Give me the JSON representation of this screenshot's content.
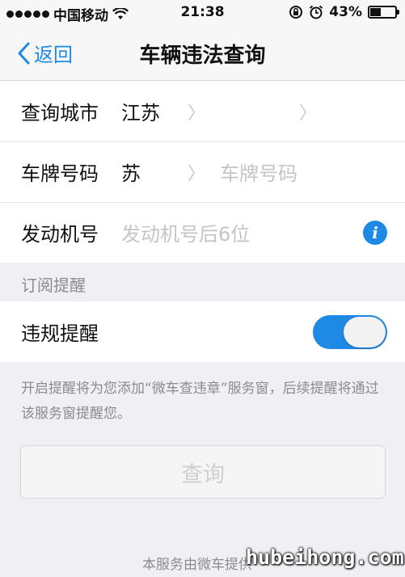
{
  "status_bar": {
    "carrier": "中国移动",
    "time": "21:38",
    "battery": "43%",
    "battery_level": 0.43,
    "icons": [
      "signal-dots-icon",
      "wifi-icon",
      "rotation-lock-icon",
      "alarm-icon",
      "battery-icon"
    ]
  },
  "nav": {
    "back_label": "返回",
    "title": "车辆违法查询"
  },
  "form": {
    "city": {
      "label": "查询城市",
      "value": "江苏"
    },
    "plate": {
      "label": "车牌号码",
      "prefix": "苏",
      "placeholder": "车牌号码"
    },
    "engine": {
      "label": "发动机号",
      "placeholder": "发动机号后6位"
    }
  },
  "subscribe": {
    "section_title": "订阅提醒",
    "toggle_label": "违规提醒",
    "toggle_on": true,
    "hint": "开启提醒将为您添加“微车查违章”服务窗，后续提醒将通过该服务窗提醒您。"
  },
  "query_button_label": "查询",
  "footer_text": "本服务由微车提供",
  "watermark": "hubeihong.com",
  "colors": {
    "accent": "#1f8ae6",
    "background": "#efeff4",
    "placeholder": "#c5c5c5"
  }
}
